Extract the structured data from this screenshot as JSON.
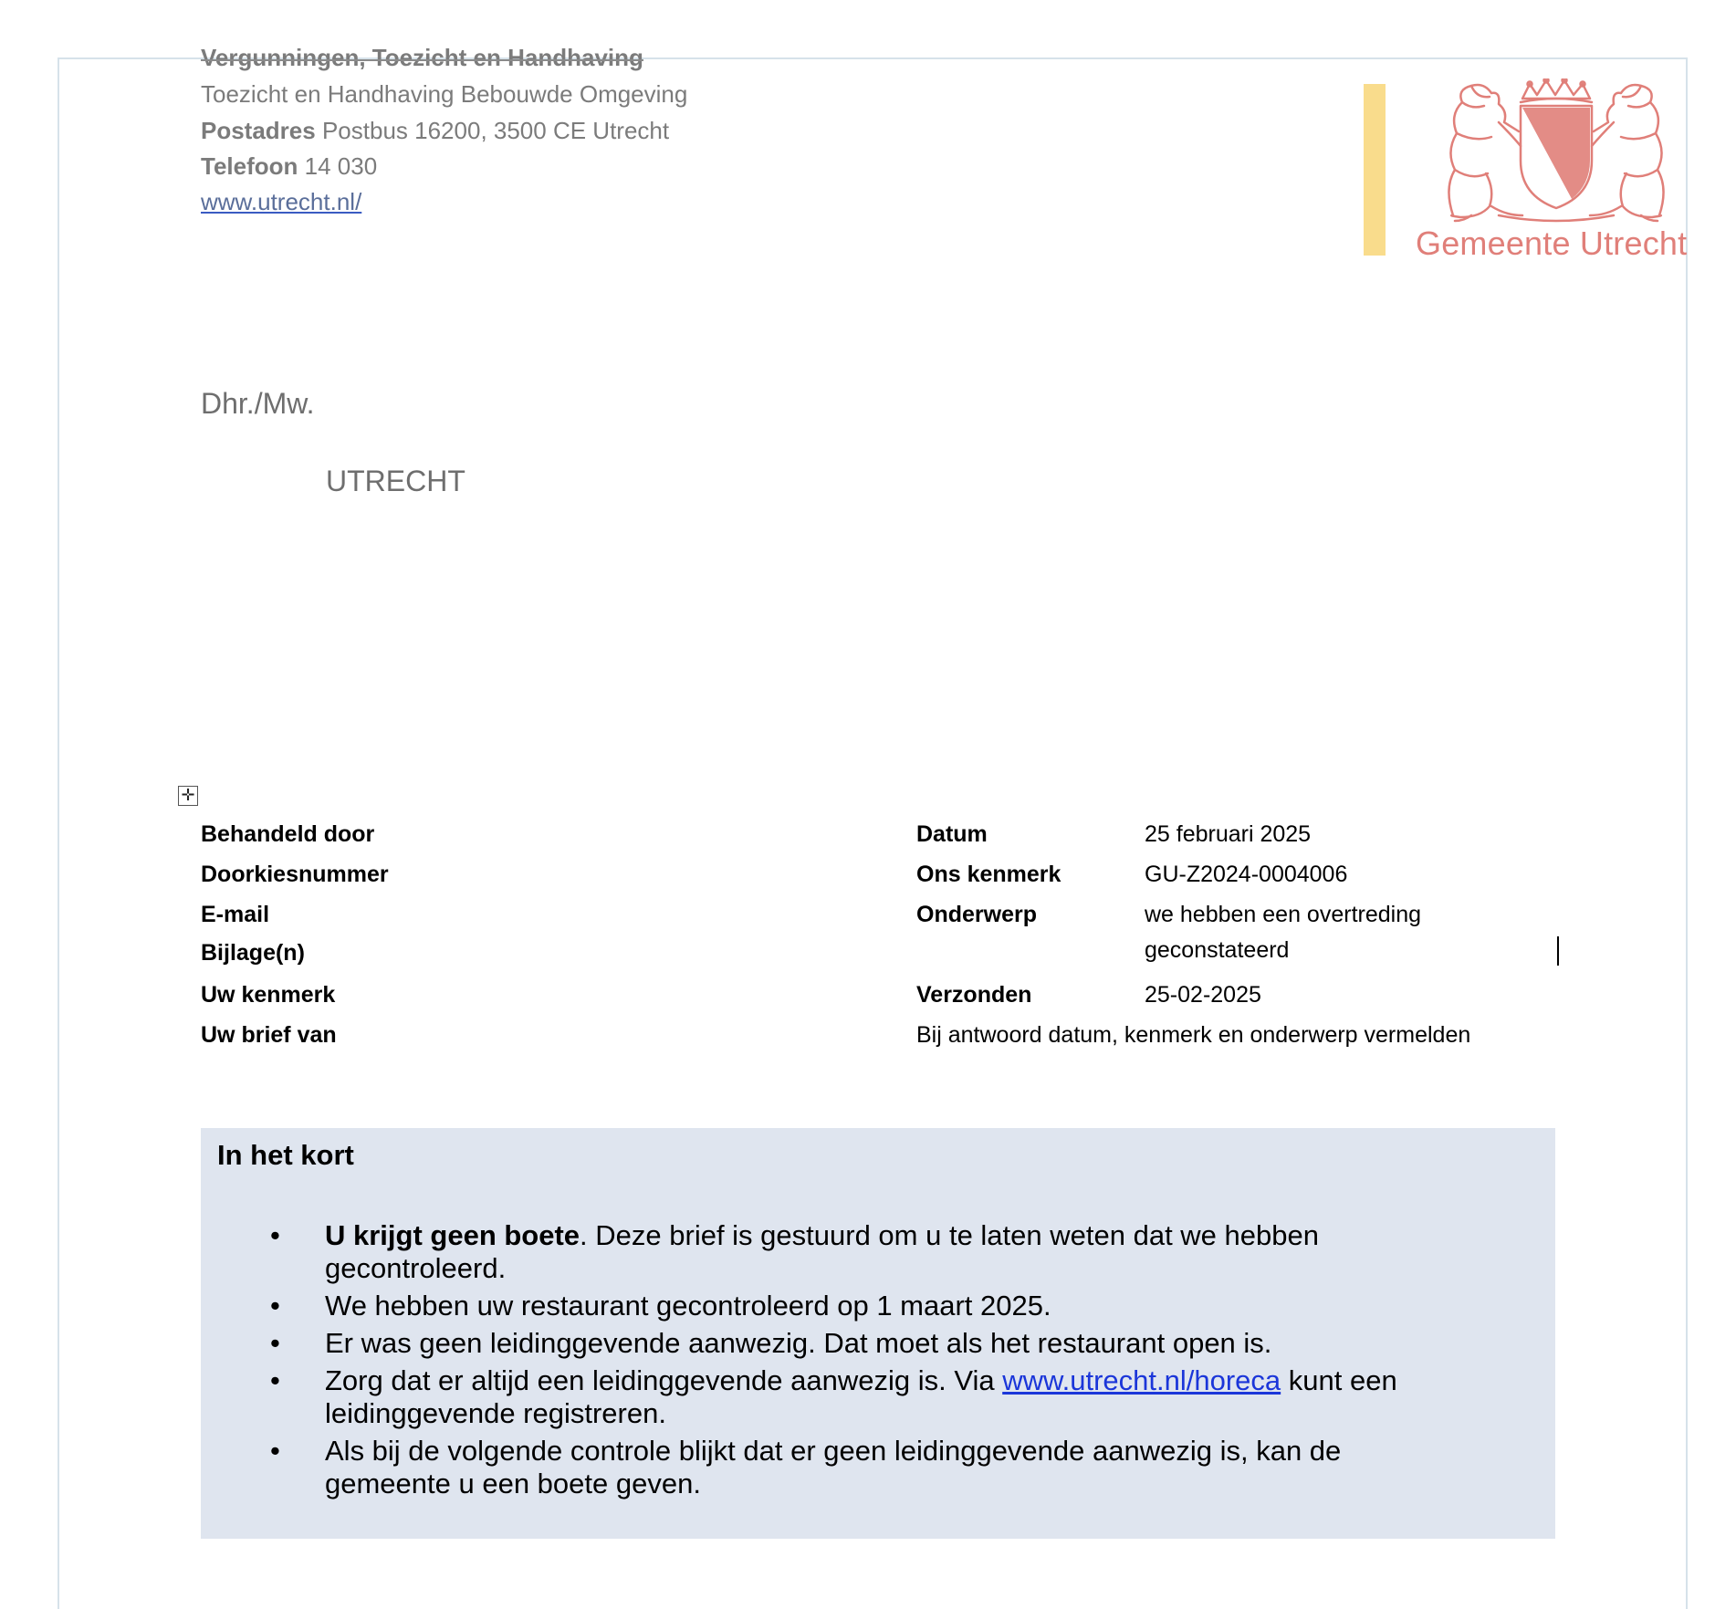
{
  "header": {
    "department": "Vergunningen, Toezicht en Handhaving",
    "division": "Toezicht en Handhaving Bebouwde Omgeving",
    "postadres_label": "Postadres",
    "postadres_value": "Postbus 16200, 3500 CE Utrecht",
    "telefoon_label": "Telefoon",
    "telefoon_value": "14 030",
    "website": "www.utrecht.nl/"
  },
  "logo": {
    "name": "Gemeente Utrecht",
    "crest_icon": "utrecht-coat-of-arms-icon",
    "bar_color": "#f9dc8c",
    "brand_color": "#e07f79"
  },
  "recipient": {
    "salutation": "Dhr./Mw.",
    "city": "UTRECHT"
  },
  "meta": {
    "left": [
      {
        "label": "Behandeld door",
        "value": ""
      },
      {
        "label": "Doorkiesnummer",
        "value": ""
      },
      {
        "label": "E-mail",
        "value": ""
      },
      {
        "label": "Bijlage(n)",
        "value": ""
      },
      {
        "label": "Uw kenmerk",
        "value": ""
      },
      {
        "label": "Uw brief van",
        "value": ""
      }
    ],
    "right": [
      {
        "label": "Datum",
        "value": "25 februari 2025"
      },
      {
        "label": "Ons kenmerk",
        "value": "GU-Z2024-0004006"
      },
      {
        "label": "Onderwerp",
        "value_line1": "we hebben een overtreding",
        "value_line2": "geconstateerd"
      },
      {
        "label": "Verzonden",
        "value": "25-02-2025"
      }
    ],
    "note": "Bij antwoord datum, kenmerk en onderwerp vermelden"
  },
  "summary": {
    "title": "In het kort",
    "bullets": [
      {
        "bold": "U krijgt geen boete",
        "text": ". Deze brief is gestuurd om u te laten weten dat we hebben gecontroleerd."
      },
      {
        "text": "We hebben uw restaurant gecontroleerd op 1 maart 2025."
      },
      {
        "text": "Er was geen leidinggevende aanwezig. Dat moet als het restaurant open is."
      },
      {
        "text_before": "Zorg dat er altijd een leidinggevende aanwezig is. Via ",
        "link": "www.utrecht.nl/horeca",
        "text_after": " kunt een leidinggevende registreren."
      },
      {
        "text": "Als bij de volgende controle blijkt dat er geen leidinggevende aanwezig is, kan de gemeente u een boete geven."
      }
    ],
    "background": "#dfe5ef"
  }
}
